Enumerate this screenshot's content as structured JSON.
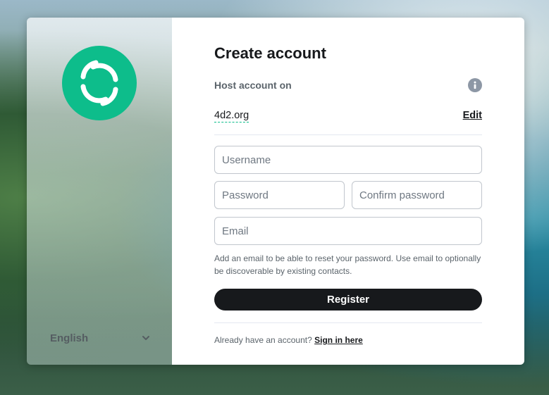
{
  "sidebar": {
    "logo_icon": "element-logo-icon",
    "language": "English",
    "brand_color": "#0dbd8b"
  },
  "form": {
    "title": "Create account",
    "host_label": "Host account on",
    "server": "4d2.org",
    "edit_label": "Edit",
    "username_placeholder": "Username",
    "password_placeholder": "Password",
    "confirm_password_placeholder": "Confirm password",
    "email_placeholder": "Email",
    "email_hint": "Add an email to be able to reset your password. Use email to optionally be discoverable by existing contacts.",
    "register_label": "Register",
    "already_text": "Already have an account?",
    "signin_label": "Sign in here"
  }
}
